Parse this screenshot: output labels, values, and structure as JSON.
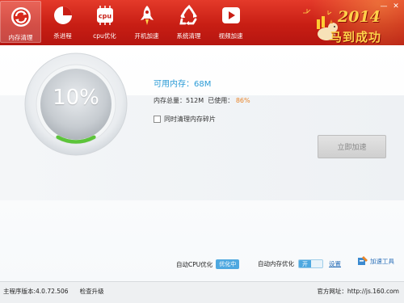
{
  "nav": {
    "items": [
      {
        "label": "内存清理",
        "icon": "memory-clean-icon"
      },
      {
        "label": "杀进程",
        "icon": "kill-process-icon"
      },
      {
        "label": "cpu优化",
        "icon": "cpu-icon"
      },
      {
        "label": "开机加速",
        "icon": "rocket-icon"
      },
      {
        "label": "系统清理",
        "icon": "recycle-icon"
      },
      {
        "label": "视频加速",
        "icon": "video-play-icon"
      }
    ]
  },
  "window": {
    "minimize": "—",
    "close": "✕"
  },
  "brand": {
    "year": "2014",
    "slogan": "马到成功"
  },
  "gauge": {
    "percent_text": "10%",
    "value": 0.1
  },
  "memory": {
    "available_label": "可用内存：",
    "available_value": "68M",
    "total_label": "内存总量：",
    "total_value": "512M",
    "used_label": "已使用：",
    "used_value": "86%",
    "checkbox_label": "同时清理内存碎片",
    "checked": false
  },
  "accelerate_button": "立即加速",
  "options": {
    "auto_cpu_label": "自动CPU优化",
    "auto_cpu_pill": "优化中",
    "auto_mem_label": "自动内存优化",
    "auto_mem_state": "开",
    "settings_link": "设置",
    "tools_label": "加速工具"
  },
  "status": {
    "version": "主程序版本:4.0.72.506",
    "check_update": "检查升级",
    "website": "官方网址：http://js.160.com"
  },
  "colors": {
    "header": "#c81e14",
    "accent": "#2a9bd6",
    "orange": "#e8852a",
    "progress": "#5cc43a"
  }
}
